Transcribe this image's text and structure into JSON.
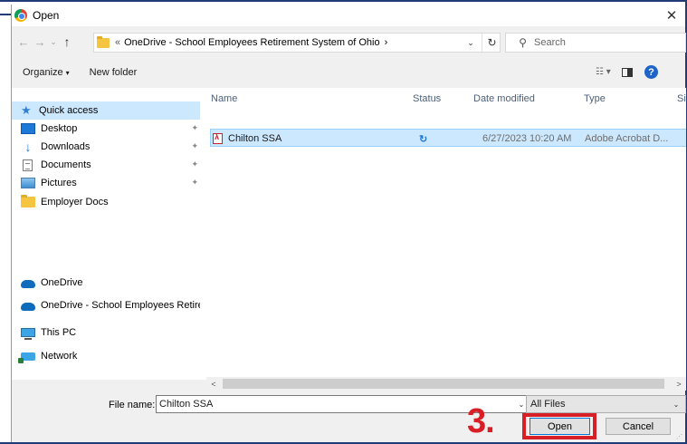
{
  "window": {
    "title": "Open",
    "close_glyph": "✕",
    "app_icon": "chrome-icon"
  },
  "address": {
    "back_glyph": "←",
    "forward_glyph": "→",
    "history_glyph": "⌄",
    "up_glyph": "↑",
    "crumb_separator": "«",
    "path": "OneDrive - School Employees Retirement System of Ohio",
    "crumb_arrow": "›",
    "dropdown_glyph": "⌄",
    "refresh_glyph": "↻"
  },
  "search": {
    "placeholder": "Search",
    "icon_glyph": "⚲"
  },
  "toolbar": {
    "organize_label": "Organize",
    "organize_caret": "▾",
    "new_folder_label": "New folder",
    "view_glyph": "☷ ▾",
    "help_glyph": "?"
  },
  "sidebar": {
    "items": [
      {
        "label": "Quick access",
        "icon": "star-icon",
        "selected": true
      },
      {
        "label": "Desktop",
        "icon": "desktop-icon",
        "pinned": true
      },
      {
        "label": "Downloads",
        "icon": "downloads-icon",
        "pinned": true
      },
      {
        "label": "Documents",
        "icon": "documents-icon",
        "pinned": true
      },
      {
        "label": "Pictures",
        "icon": "pictures-icon",
        "pinned": true
      },
      {
        "label": "Employer Docs",
        "icon": "folder-icon"
      },
      {
        "label": "OneDrive",
        "icon": "cloud-icon"
      },
      {
        "label": "OneDrive - School Employees Retirem",
        "icon": "cloud-icon"
      },
      {
        "label": "This PC",
        "icon": "computer-icon"
      },
      {
        "label": "Network",
        "icon": "network-icon"
      }
    ],
    "pin_glyph": "📌"
  },
  "file_list": {
    "columns": [
      "Name",
      "Status",
      "Date modified",
      "Type",
      "Siz"
    ],
    "sort_glyph": "^",
    "rows": [
      {
        "name": "Chilton SSA",
        "status_glyph": "↻",
        "date_modified": "6/27/2023 10:20 AM",
        "type": "Adobe Acrobat D...",
        "icon": "pdf-icon",
        "selected": true
      }
    ]
  },
  "scrollbar": {
    "left_glyph": "<",
    "right_glyph": ">"
  },
  "bottom": {
    "file_name_label": "File name:",
    "file_name_value": "Chilton SSA",
    "dropdown_glyph": "⌄",
    "filter_value": "All Files",
    "open_label": "Open",
    "cancel_label": "Cancel",
    "step_annotation": "3."
  },
  "colors": {
    "accent": "#0078d7",
    "selection": "#cce8ff",
    "annotation_red": "#d81f26",
    "frame_blue": "#1f3b78"
  }
}
